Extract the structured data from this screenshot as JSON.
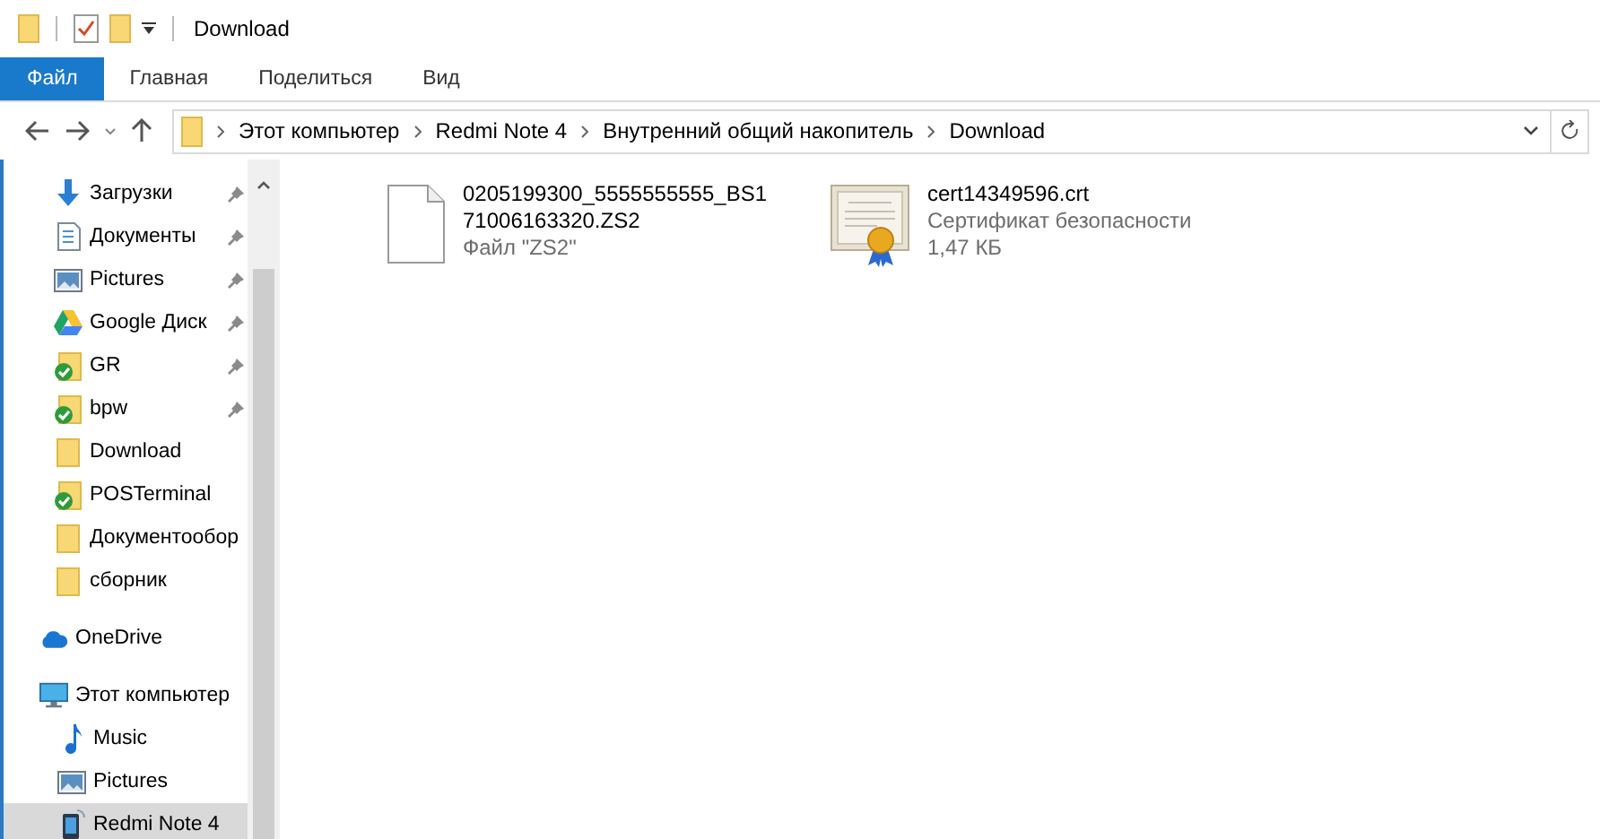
{
  "window": {
    "title": "Download"
  },
  "ribbon": {
    "tabs": [
      {
        "label": "Файл",
        "kind": "file"
      },
      {
        "label": "Главная",
        "kind": "tab"
      },
      {
        "label": "Поделиться",
        "kind": "tab"
      },
      {
        "label": "Вид",
        "kind": "tab"
      }
    ]
  },
  "address": {
    "path": [
      "Этот компьютер",
      "Redmi Note 4",
      "Внутренний общий накопитель",
      "Download"
    ]
  },
  "sidebar": {
    "quick_access": [
      {
        "label": "Загрузки",
        "kind": "download",
        "pinned": true,
        "selected": false
      },
      {
        "label": "Документы",
        "kind": "documents",
        "pinned": true,
        "selected": false
      },
      {
        "label": "Pictures",
        "kind": "pictures",
        "pinned": true,
        "selected": false
      },
      {
        "label": "Google Диск",
        "kind": "gdrive",
        "pinned": true,
        "selected": false
      },
      {
        "label": "GR",
        "kind": "synced",
        "pinned": true,
        "selected": false
      },
      {
        "label": "bpw",
        "kind": "synced",
        "pinned": true,
        "selected": false
      },
      {
        "label": "Download",
        "kind": "folder",
        "pinned": false,
        "selected": false
      },
      {
        "label": "POSTerminal",
        "kind": "synced",
        "pinned": false,
        "selected": false
      },
      {
        "label": "Документообор",
        "kind": "folder",
        "pinned": false,
        "selected": false
      },
      {
        "label": "сборник",
        "kind": "folder",
        "pinned": false,
        "selected": false
      }
    ],
    "items": [
      {
        "label": "OneDrive",
        "kind": "cloud",
        "selected": false
      },
      {
        "label": "Этот компьютер",
        "kind": "computer",
        "selected": false,
        "children": [
          {
            "label": "Music",
            "kind": "music",
            "selected": false
          },
          {
            "label": "Pictures",
            "kind": "pictures",
            "selected": false
          },
          {
            "label": "Redmi Note 4",
            "kind": "phone",
            "selected": true
          }
        ]
      }
    ]
  },
  "files": [
    {
      "name": "0205199300_5555555555_BS171006163320.ZS2",
      "type": "Файл \"ZS2\"",
      "kind": "file"
    },
    {
      "name": "cert14349596.crt",
      "type": "Сертификат безопасности",
      "size": "1,47 КБ",
      "kind": "certificate"
    }
  ]
}
